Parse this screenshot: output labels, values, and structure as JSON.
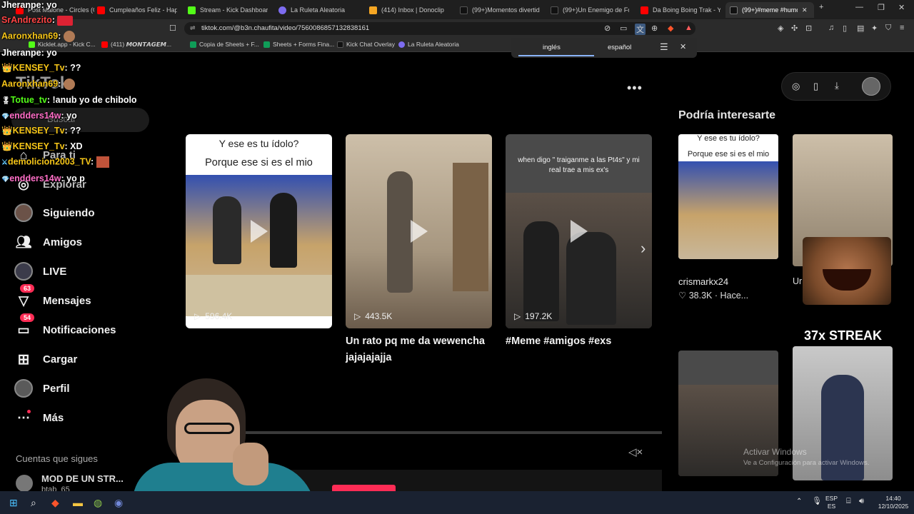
{
  "tabs": [
    {
      "label": "Post Malone - Circles (Offi",
      "color": "#ff0000"
    },
    {
      "label": "Cumpleaños Feliz - Happy",
      "color": "#ff0000"
    },
    {
      "label": "Stream - Kick Dashboard",
      "color": "#53fc18"
    },
    {
      "label": "La Ruleta Aleatoria",
      "color": "#7d6cf0"
    },
    {
      "label": "(414) Inbox | Donoclip",
      "color": "#f5a623"
    },
    {
      "label": "(99+)Momentos divertido",
      "color": "#111111"
    },
    {
      "label": "(99+)Un Enemigo de Fortr",
      "color": "#111111"
    },
    {
      "label": "Da Boing Boing Trak - You",
      "color": "#ff0000"
    },
    {
      "label": "(99+)#meme #humor",
      "color": "#111111"
    }
  ],
  "window_controls": [
    "—",
    "❐",
    "✕"
  ],
  "url": "tiktok.com/@b3n.chaufita/video/7560086857132838161",
  "bookmarks": [
    {
      "label": "Kicklet.app - Kick C...",
      "color": "#53fc18"
    },
    {
      "label": "(411) 𝙈𝙊𝙉𝙏𝘼𝙂𝙀𝙈...",
      "color": "#ff0000"
    },
    {
      "label": "Copia de Sheets + F...",
      "color": "#0f9d58"
    },
    {
      "label": "Sheets + Forms Fina...",
      "color": "#0f9d58"
    },
    {
      "label": "Kick Chat Overlay",
      "color": "#111111"
    },
    {
      "label": "La Ruleta Aleatoria",
      "color": "#7d6cf0"
    }
  ],
  "translate": {
    "lang_from": "inglés",
    "lang_to": "español"
  },
  "tiktok": {
    "logo": "TikTok",
    "search_placeholder": "Buscar",
    "nav": [
      {
        "label": "Para ti",
        "icon": "home-icon"
      },
      {
        "label": "Explorar",
        "icon": "compass-icon"
      },
      {
        "label": "Siguiendo",
        "icon": "avatar"
      },
      {
        "label": "Amigos",
        "icon": "friends-icon"
      },
      {
        "label": "LIVE",
        "icon": "live-icon"
      },
      {
        "label": "Mensajes",
        "icon": "messages-icon",
        "badge": "63"
      },
      {
        "label": "Notificaciones",
        "icon": "inbox-icon",
        "badge": "54"
      },
      {
        "label": "Cargar",
        "icon": "upload-icon"
      },
      {
        "label": "Perfil",
        "icon": "profile-icon"
      },
      {
        "label": "Más",
        "icon": "more-icon"
      }
    ],
    "following_title": "Cuentas que sigues",
    "following": [
      {
        "name": "MOD DE UN STR...",
        "handle": "btab_65"
      }
    ],
    "more_menu": "•••",
    "videos": [
      {
        "caption_top": "Y ese es tu ídolo?",
        "caption_bottom": "Porque ese si es el mio",
        "views": "596.4K",
        "title": ""
      },
      {
        "caption_top": "",
        "caption_bottom": "",
        "views": "443.5K",
        "title": "Un rato pq me da wewencha jajajajajja"
      },
      {
        "caption_top": "when digo \" traiganme a las Pt4s\" y mi real trae a mis ex's",
        "caption_bottom": "",
        "views": "197.2K",
        "title": "#Meme #amigos #exs"
      }
    ],
    "recommend_title": "Podría interesarte",
    "recommend": [
      {
        "caption_top": "Y ese es tu ídolo?",
        "caption_bottom": "Porque ese si es el mio",
        "user": "crismarkx24",
        "likes": "38.3K",
        "time": "Hace..."
      },
      {
        "user": "Ur",
        "likes": "",
        "time": "Hace..."
      }
    ],
    "streak": "37x STREAK",
    "activate_windows": {
      "line1": "Activar Windows",
      "line2": "Ve a Configuración para activar Windows."
    }
  },
  "chat": [
    {
      "user": "Jheranpe",
      "text": "yo",
      "color": "#ffffff",
      "badge": ""
    },
    {
      "user": "SrAndrezito",
      "text": "",
      "color": "#ff4444",
      "badge": ""
    },
    {
      "user": "Aaronxhan69",
      "text": "",
      "color": "#f5c518",
      "badge": ""
    },
    {
      "user": "Jheranpe",
      "text": "yo",
      "color": "#ffffff",
      "badge": ""
    },
    {
      "user": "KENSEY_Tv",
      "text": "??",
      "color": "#f5c518",
      "badge": "👑"
    },
    {
      "user": "Aaronxhan69",
      "text": "",
      "color": "#f5c518",
      "badge": ""
    },
    {
      "user": "Totue_tv",
      "text": "!anub yo de chibolo",
      "color": "#53fc18",
      "badge": "🎖"
    },
    {
      "user": "endders14w",
      "text": "yo",
      "color": "#ff6ec7",
      "badge": "💎"
    },
    {
      "user": "KENSEY_Tv",
      "text": "??",
      "color": "#f5c518",
      "badge": "👑"
    },
    {
      "user": "KENSEY_Tv",
      "text": "XD",
      "color": "#f5c518",
      "badge": "👑"
    },
    {
      "user": "demolicion2003_TV",
      "text": "",
      "color": "#f5c518",
      "badge": "⚔"
    },
    {
      "user": "endders14w",
      "text": "yo p",
      "color": "#ff6ec7",
      "badge": "💎"
    }
  ],
  "taskbar": {
    "lang": "ESP",
    "lang_sub": "ES",
    "time": "14:40",
    "date": "12/10/2025"
  },
  "colors": {
    "accent": "#fe2c55",
    "bg": "#000000",
    "chrome": "#2b2b2b"
  }
}
